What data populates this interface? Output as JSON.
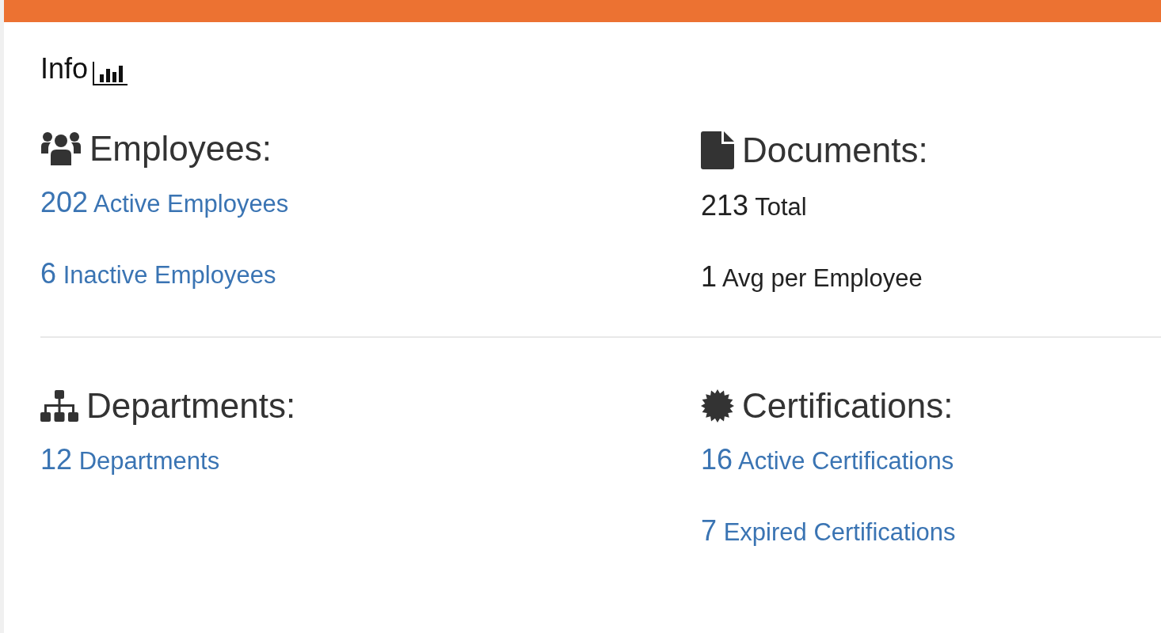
{
  "panel": {
    "title": "Info"
  },
  "sections": [
    {
      "title": "Employees:",
      "items": [
        {
          "kind": "link",
          "number": "202",
          "label": "Active Employees"
        },
        {
          "kind": "link",
          "number": "6",
          "label": "Inactive Employees"
        }
      ]
    },
    {
      "title": "Documents:",
      "items": [
        {
          "kind": "plain",
          "number": "213",
          "label": "Total"
        },
        {
          "kind": "plain",
          "number": "1",
          "label": "Avg per Employee"
        }
      ]
    },
    {
      "title": "Departments:",
      "items": [
        {
          "kind": "link",
          "number": "12",
          "label": "Departments"
        }
      ]
    },
    {
      "title": "Certifications:",
      "items": [
        {
          "kind": "link",
          "number": "16",
          "label": "Active Certifications"
        },
        {
          "kind": "link",
          "number": "7",
          "label": "Expired Certifications"
        }
      ]
    }
  ]
}
